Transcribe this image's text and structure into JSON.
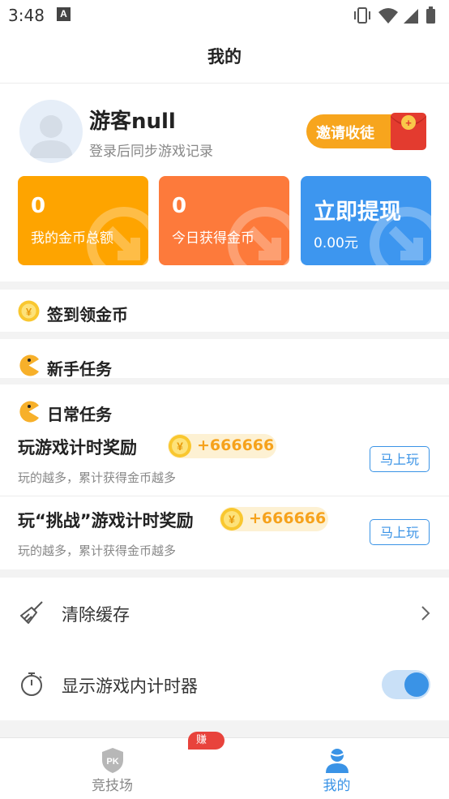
{
  "status_bar": {
    "time": "3:48",
    "notification_letter": "A"
  },
  "header": {
    "title": "我的"
  },
  "profile": {
    "username": "游客null",
    "subtitle": "登录后同步游戏记录",
    "invite_label": "邀请收徒"
  },
  "cards": [
    {
      "value": "0",
      "label": "我的金币总额",
      "color": "#fea400"
    },
    {
      "value": "0",
      "label": "今日获得金币",
      "color": "#fd7a3b"
    },
    {
      "title": "立即提现",
      "label": "0.00元",
      "color": "#3d96ef"
    }
  ],
  "sections": {
    "checkin": "签到领金币",
    "newbie": "新手任务",
    "daily": "日常任务"
  },
  "tasks": [
    {
      "name": "玩游戏计时奖励",
      "reward": "+666666",
      "desc": "玩的越多，累计获得金币越多",
      "button": "马上玩"
    },
    {
      "name": "玩“挑战”游戏计时奖励",
      "reward": "+666666",
      "desc": "玩的越多，累计获得金币越多",
      "button": "马上玩"
    }
  ],
  "settings": {
    "clear_cache": "清除缓存",
    "show_timer": "显示游戏内计时器",
    "show_timer_enabled": true
  },
  "bottom_nav": {
    "arena": "竞技场",
    "arena_badge": "赚钱",
    "mine": "我的",
    "active_color": "#3a93e6"
  }
}
